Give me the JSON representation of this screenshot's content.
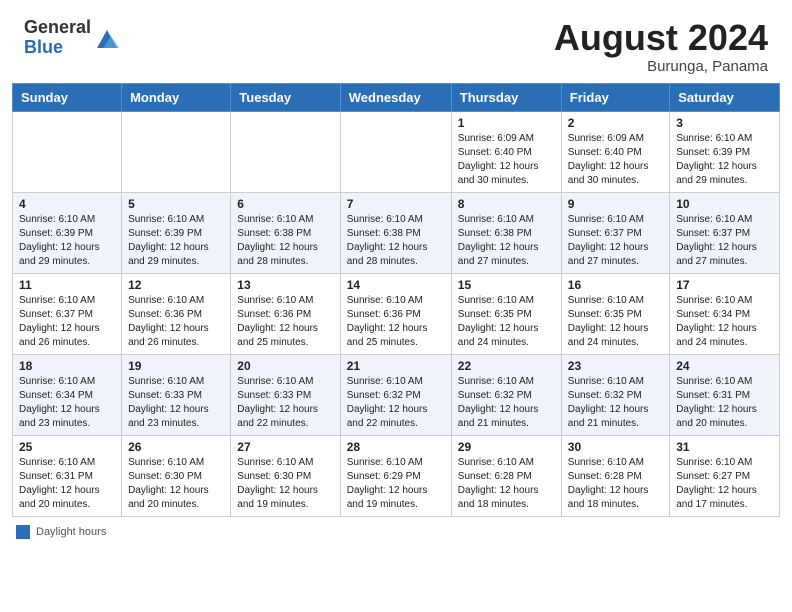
{
  "header": {
    "logo_general": "General",
    "logo_blue": "Blue",
    "month_year": "August 2024",
    "location": "Burunga, Panama"
  },
  "weekdays": [
    "Sunday",
    "Monday",
    "Tuesday",
    "Wednesday",
    "Thursday",
    "Friday",
    "Saturday"
  ],
  "weeks": [
    [
      {
        "day": "",
        "info": ""
      },
      {
        "day": "",
        "info": ""
      },
      {
        "day": "",
        "info": ""
      },
      {
        "day": "",
        "info": ""
      },
      {
        "day": "1",
        "info": "Sunrise: 6:09 AM\nSunset: 6:40 PM\nDaylight: 12 hours\nand 30 minutes."
      },
      {
        "day": "2",
        "info": "Sunrise: 6:09 AM\nSunset: 6:40 PM\nDaylight: 12 hours\nand 30 minutes."
      },
      {
        "day": "3",
        "info": "Sunrise: 6:10 AM\nSunset: 6:39 PM\nDaylight: 12 hours\nand 29 minutes."
      }
    ],
    [
      {
        "day": "4",
        "info": "Sunrise: 6:10 AM\nSunset: 6:39 PM\nDaylight: 12 hours\nand 29 minutes."
      },
      {
        "day": "5",
        "info": "Sunrise: 6:10 AM\nSunset: 6:39 PM\nDaylight: 12 hours\nand 29 minutes."
      },
      {
        "day": "6",
        "info": "Sunrise: 6:10 AM\nSunset: 6:38 PM\nDaylight: 12 hours\nand 28 minutes."
      },
      {
        "day": "7",
        "info": "Sunrise: 6:10 AM\nSunset: 6:38 PM\nDaylight: 12 hours\nand 28 minutes."
      },
      {
        "day": "8",
        "info": "Sunrise: 6:10 AM\nSunset: 6:38 PM\nDaylight: 12 hours\nand 27 minutes."
      },
      {
        "day": "9",
        "info": "Sunrise: 6:10 AM\nSunset: 6:37 PM\nDaylight: 12 hours\nand 27 minutes."
      },
      {
        "day": "10",
        "info": "Sunrise: 6:10 AM\nSunset: 6:37 PM\nDaylight: 12 hours\nand 27 minutes."
      }
    ],
    [
      {
        "day": "11",
        "info": "Sunrise: 6:10 AM\nSunset: 6:37 PM\nDaylight: 12 hours\nand 26 minutes."
      },
      {
        "day": "12",
        "info": "Sunrise: 6:10 AM\nSunset: 6:36 PM\nDaylight: 12 hours\nand 26 minutes."
      },
      {
        "day": "13",
        "info": "Sunrise: 6:10 AM\nSunset: 6:36 PM\nDaylight: 12 hours\nand 25 minutes."
      },
      {
        "day": "14",
        "info": "Sunrise: 6:10 AM\nSunset: 6:36 PM\nDaylight: 12 hours\nand 25 minutes."
      },
      {
        "day": "15",
        "info": "Sunrise: 6:10 AM\nSunset: 6:35 PM\nDaylight: 12 hours\nand 24 minutes."
      },
      {
        "day": "16",
        "info": "Sunrise: 6:10 AM\nSunset: 6:35 PM\nDaylight: 12 hours\nand 24 minutes."
      },
      {
        "day": "17",
        "info": "Sunrise: 6:10 AM\nSunset: 6:34 PM\nDaylight: 12 hours\nand 24 minutes."
      }
    ],
    [
      {
        "day": "18",
        "info": "Sunrise: 6:10 AM\nSunset: 6:34 PM\nDaylight: 12 hours\nand 23 minutes."
      },
      {
        "day": "19",
        "info": "Sunrise: 6:10 AM\nSunset: 6:33 PM\nDaylight: 12 hours\nand 23 minutes."
      },
      {
        "day": "20",
        "info": "Sunrise: 6:10 AM\nSunset: 6:33 PM\nDaylight: 12 hours\nand 22 minutes."
      },
      {
        "day": "21",
        "info": "Sunrise: 6:10 AM\nSunset: 6:32 PM\nDaylight: 12 hours\nand 22 minutes."
      },
      {
        "day": "22",
        "info": "Sunrise: 6:10 AM\nSunset: 6:32 PM\nDaylight: 12 hours\nand 21 minutes."
      },
      {
        "day": "23",
        "info": "Sunrise: 6:10 AM\nSunset: 6:32 PM\nDaylight: 12 hours\nand 21 minutes."
      },
      {
        "day": "24",
        "info": "Sunrise: 6:10 AM\nSunset: 6:31 PM\nDaylight: 12 hours\nand 20 minutes."
      }
    ],
    [
      {
        "day": "25",
        "info": "Sunrise: 6:10 AM\nSunset: 6:31 PM\nDaylight: 12 hours\nand 20 minutes."
      },
      {
        "day": "26",
        "info": "Sunrise: 6:10 AM\nSunset: 6:30 PM\nDaylight: 12 hours\nand 20 minutes."
      },
      {
        "day": "27",
        "info": "Sunrise: 6:10 AM\nSunset: 6:30 PM\nDaylight: 12 hours\nand 19 minutes."
      },
      {
        "day": "28",
        "info": "Sunrise: 6:10 AM\nSunset: 6:29 PM\nDaylight: 12 hours\nand 19 minutes."
      },
      {
        "day": "29",
        "info": "Sunrise: 6:10 AM\nSunset: 6:28 PM\nDaylight: 12 hours\nand 18 minutes."
      },
      {
        "day": "30",
        "info": "Sunrise: 6:10 AM\nSunset: 6:28 PM\nDaylight: 12 hours\nand 18 minutes."
      },
      {
        "day": "31",
        "info": "Sunrise: 6:10 AM\nSunset: 6:27 PM\nDaylight: 12 hours\nand 17 minutes."
      }
    ]
  ],
  "footer": {
    "daylight_label": "Daylight hours"
  }
}
